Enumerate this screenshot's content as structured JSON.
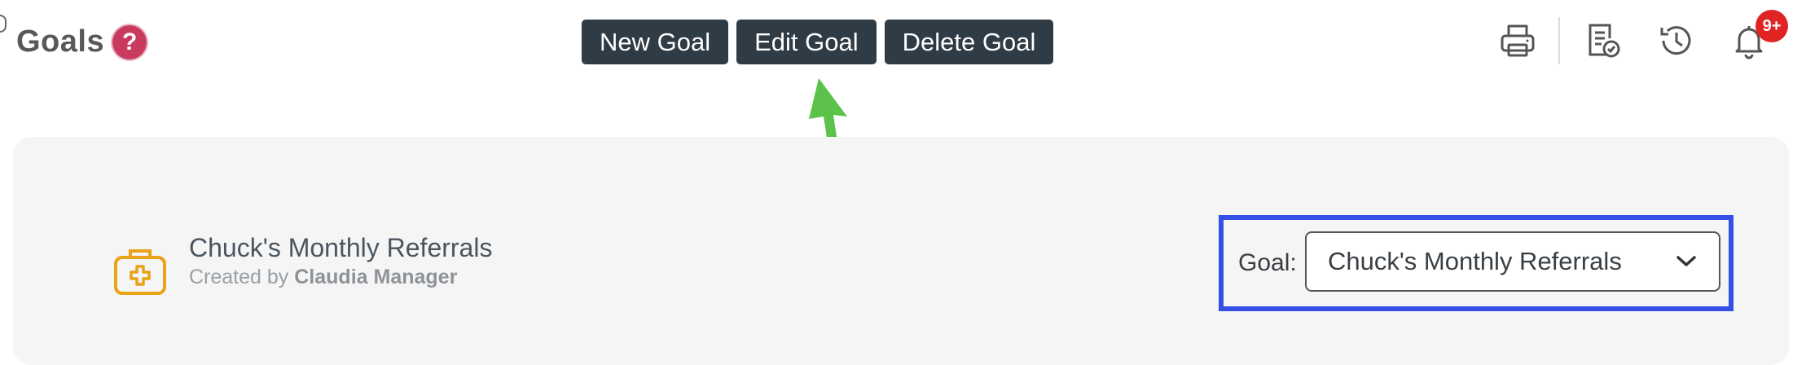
{
  "header": {
    "title": "Goals",
    "help_symbol": "?",
    "notification_count": "9+"
  },
  "toolbar": {
    "new_goal_label": "New Goal",
    "edit_goal_label": "Edit Goal",
    "delete_goal_label": "Delete Goal"
  },
  "header_icons": [
    "printer-icon",
    "report-check-icon",
    "history-icon",
    "bell-icon"
  ],
  "goal": {
    "name": "Chuck's Monthly Referrals",
    "created_prefix": "Created by ",
    "created_by": "Claudia Manager",
    "icon": "medical-kit-icon"
  },
  "goal_selector": {
    "label": "Goal:",
    "selected": "Chuck's Monthly Referrals"
  },
  "colors": {
    "button_bg": "#2f3b45",
    "help_badge": "#c93a5f",
    "notification_badge": "#e02424",
    "highlight_frame": "#3550e6",
    "annotation_arrow": "#5cc24a",
    "goal_icon": "#e8a317"
  }
}
